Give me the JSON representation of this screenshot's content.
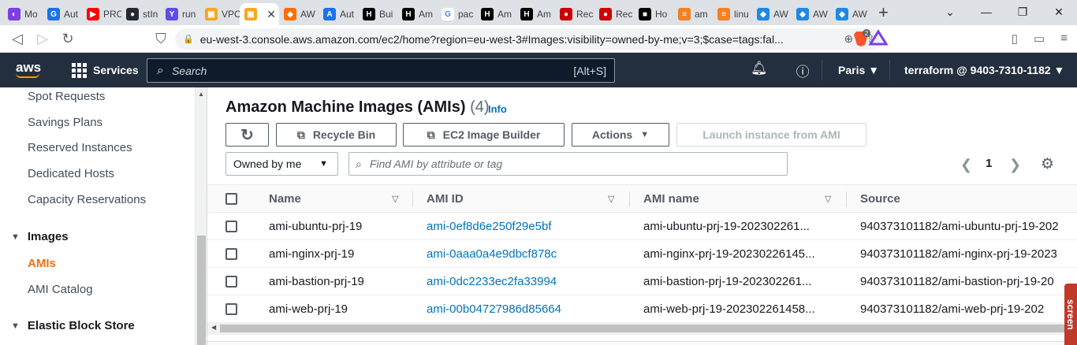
{
  "browser": {
    "tabs": [
      {
        "label": "Mo",
        "color": "#7b3fe4",
        "glyph": "◐"
      },
      {
        "label": "Aut",
        "color": "#1a73e8",
        "glyph": "G"
      },
      {
        "label": "PRC",
        "color": "#ff0000",
        "glyph": "▶"
      },
      {
        "label": "stIn",
        "color": "#24292f",
        "glyph": "●"
      },
      {
        "label": "run",
        "color": "#5c4ee5",
        "glyph": "Y"
      },
      {
        "label": "VPC",
        "color": "#f5a623",
        "glyph": "▣"
      },
      {
        "label": "",
        "color": "#f5a623",
        "glyph": "▣",
        "active": true
      },
      {
        "label": "AW",
        "color": "#ff6d00",
        "glyph": "◆"
      },
      {
        "label": "Aut",
        "color": "#1a73e8",
        "glyph": "A"
      },
      {
        "label": "Bui",
        "color": "#000000",
        "glyph": "H"
      },
      {
        "label": "Am",
        "color": "#000000",
        "glyph": "H"
      },
      {
        "label": "pac",
        "color": "#ffffff",
        "glyph": "G"
      },
      {
        "label": "Am",
        "color": "#000000",
        "glyph": "H"
      },
      {
        "label": "Am",
        "color": "#000000",
        "glyph": "H"
      },
      {
        "label": "Rec",
        "color": "#cc0000",
        "glyph": "●"
      },
      {
        "label": "Rec",
        "color": "#cc0000",
        "glyph": "●"
      },
      {
        "label": "Ho",
        "color": "#000000",
        "glyph": "■"
      },
      {
        "label": "am",
        "color": "#f48024",
        "glyph": "≡"
      },
      {
        "label": "linu",
        "color": "#f48024",
        "glyph": "≡"
      },
      {
        "label": "AW",
        "color": "#1e88e5",
        "glyph": "◆"
      },
      {
        "label": "AW",
        "color": "#1e88e5",
        "glyph": "◆"
      },
      {
        "label": "AW",
        "color": "#1e88e5",
        "glyph": "◆"
      }
    ],
    "new_tab": "+",
    "url": "eu-west-3.console.aws.amazon.com/ec2/home?region=eu-west-3#Images:visibility=owned-by-me;v=3;$case=tags:fal...",
    "brave_badge": "2"
  },
  "aws_header": {
    "logo": "aws",
    "services": "Services",
    "search_placeholder": "Search",
    "search_shortcut": "[Alt+S]",
    "region": "Paris ▼",
    "account": "terraform @ 9403-7310-1182 ▼"
  },
  "sidenav": {
    "items_top": [
      "Spot Requests",
      "Savings Plans",
      "Reserved Instances",
      "Dedicated Hosts",
      "Capacity Reservations"
    ],
    "images_header": "Images",
    "images_items": [
      "AMIs",
      "AMI Catalog"
    ],
    "ebs_header": "Elastic Block Store"
  },
  "page": {
    "title": "Amazon Machine Images (AMIs)",
    "count": "(4)",
    "info": "Info",
    "buttons": {
      "refresh": "↻",
      "recycle_bin": "Recycle Bin",
      "image_builder": "EC2 Image Builder",
      "actions": "Actions",
      "launch": "Launch instance from AMI"
    },
    "owner_filter": "Owned by me",
    "search_placeholder": "Find AMI by attribute or tag",
    "page_number": "1"
  },
  "table": {
    "columns": [
      "Name",
      "AMI ID",
      "AMI name",
      "Source"
    ],
    "rows": [
      {
        "name": "ami-ubuntu-prj-19",
        "ami_id": "ami-0ef8d6e250f29e5bf",
        "ami_name": "ami-ubuntu-prj-19-202302261...",
        "source": "940373101182/ami-ubuntu-prj-19-202"
      },
      {
        "name": "ami-nginx-prj-19",
        "ami_id": "ami-0aaa0a4e9dbcf878c",
        "ami_name": "ami-nginx-prj-19-20230226145...",
        "source": "940373101182/ami-nginx-prj-19-2023"
      },
      {
        "name": "ami-bastion-prj-19",
        "ami_id": "ami-0dc2233ec2fa33994",
        "ami_name": "ami-bastion-prj-19-202302261...",
        "source": "940373101182/ami-bastion-prj-19-20"
      },
      {
        "name": "ami-web-prj-19",
        "ami_id": "ami-00b04727986d85664",
        "ami_name": "ami-web-prj-19-202302261458...",
        "source": "940373101182/ami-web-prj-19-202"
      }
    ]
  },
  "overlay": {
    "screencast": "screen"
  }
}
